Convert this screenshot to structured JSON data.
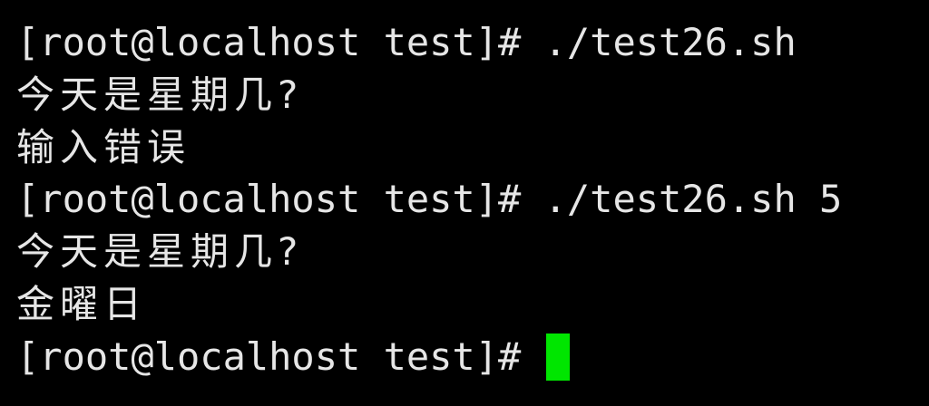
{
  "terminal": {
    "lines": [
      {
        "kind": "command",
        "prompt": "[root@localhost test]#",
        "command": "./test26.sh"
      },
      {
        "kind": "output",
        "text": "今天是星期几?"
      },
      {
        "kind": "output",
        "text": "输入错误"
      },
      {
        "kind": "command",
        "prompt": "[root@localhost test]#",
        "command": "./test26.sh 5"
      },
      {
        "kind": "output",
        "text": "今天是星期几?"
      },
      {
        "kind": "output",
        "text": "金曜日"
      },
      {
        "kind": "prompt",
        "prompt": "[root@localhost test]#"
      }
    ],
    "cursor_color": "#00e600",
    "background": "#000000",
    "foreground": "#e6e6e6"
  }
}
